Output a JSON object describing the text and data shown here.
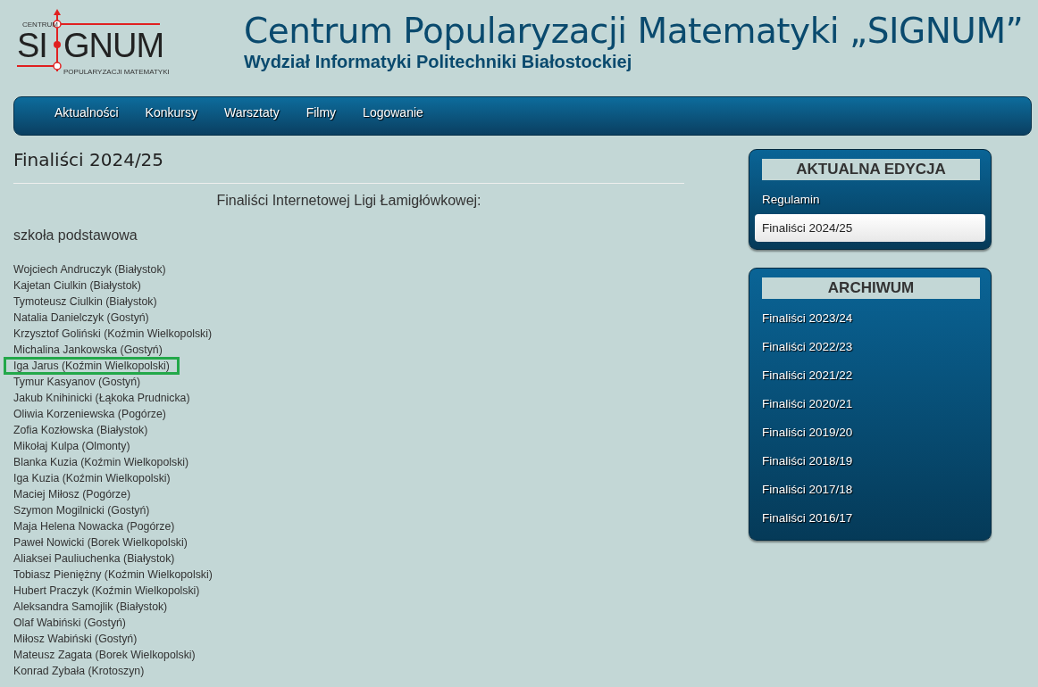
{
  "logo": {
    "top": "CENTRUM",
    "left": "SI",
    "right": "GNUM",
    "bottom": "POPULARYZACJI MATEMATYKI"
  },
  "header": {
    "title": "Centrum Popularyzacji Matematyki „SIGNUM”",
    "subtitle": "Wydział Informatyki Politechniki Białostockiej"
  },
  "nav": [
    "Aktualności",
    "Konkursy",
    "Warsztaty",
    "Filmy",
    "Logowanie"
  ],
  "page_title": "Finaliści 2024/25",
  "intro": "Finaliści Internetowej Ligi Łamigłówkowej:",
  "section": "szkoła podstawowa",
  "finalists": [
    {
      "text": "Wojciech Andruczyk (Białystok)",
      "highlighted": false
    },
    {
      "text": "Kajetan Ciulkin (Białystok)",
      "highlighted": false
    },
    {
      "text": "Tymoteusz Ciulkin (Białystok)",
      "highlighted": false
    },
    {
      "text": "Natalia Danielczyk (Gostyń)",
      "highlighted": false
    },
    {
      "text": "Krzysztof Goliński (Koźmin Wielkopolski)",
      "highlighted": false
    },
    {
      "text": "Michalina Jankowska (Gostyń)",
      "highlighted": false
    },
    {
      "text": "Iga Jarus (Koźmin Wielkopolski)",
      "highlighted": true
    },
    {
      "text": "Tymur Kasyanov (Gostyń)",
      "highlighted": false
    },
    {
      "text": "Jakub Knihinicki (Łąkoka Prudnicka)",
      "highlighted": false
    },
    {
      "text": "Oliwia Korzeniewska (Pogórze)",
      "highlighted": false
    },
    {
      "text": "Zofia Kozłowska (Białystok)",
      "highlighted": false
    },
    {
      "text": "Mikołaj Kulpa (Olmonty)",
      "highlighted": false
    },
    {
      "text": "Blanka Kuzia (Koźmin Wielkopolski)",
      "highlighted": false
    },
    {
      "text": "Iga Kuzia (Koźmin Wielkopolski)",
      "highlighted": false
    },
    {
      "text": "Maciej Miłosz (Pogórze)",
      "highlighted": false
    },
    {
      "text": "Szymon Mogilnicki (Gostyń)",
      "highlighted": false
    },
    {
      "text": "Maja Helena Nowacka (Pogórze)",
      "highlighted": false
    },
    {
      "text": "Paweł Nowicki (Borek Wielkopolski)",
      "highlighted": false
    },
    {
      "text": "Aliaksei Pauliuchenka (Białystok)",
      "highlighted": false
    },
    {
      "text": "Tobiasz Pieniężny (Koźmin Wielkopolski)",
      "highlighted": false
    },
    {
      "text": "Hubert Praczyk (Koźmin Wielkopolski)",
      "highlighted": false
    },
    {
      "text": "Aleksandra Samojlik (Białystok)",
      "highlighted": false
    },
    {
      "text": "Olaf Wabiński (Gostyń)",
      "highlighted": false
    },
    {
      "text": "Miłosz Wabiński (Gostyń)",
      "highlighted": false
    },
    {
      "text": "Mateusz Zagata (Borek Wielkopolski)",
      "highlighted": false
    },
    {
      "text": "Konrad Zybała (Krotoszyn)",
      "highlighted": false
    }
  ],
  "sidebar": [
    {
      "title": "AKTUALNA EDYCJA",
      "items": [
        {
          "label": "Regulamin",
          "selected": false
        },
        {
          "label": "Finaliści 2024/25",
          "selected": true
        }
      ]
    },
    {
      "title": "ARCHIWUM",
      "items": [
        {
          "label": "Finaliści 2023/24",
          "selected": false
        },
        {
          "label": "Finaliści 2022/23",
          "selected": false
        },
        {
          "label": "Finaliści 2021/22",
          "selected": false
        },
        {
          "label": "Finaliści 2020/21",
          "selected": false
        },
        {
          "label": "Finaliści 2019/20",
          "selected": false
        },
        {
          "label": "Finaliści 2018/19",
          "selected": false
        },
        {
          "label": "Finaliści 2017/18",
          "selected": false
        },
        {
          "label": "Finaliści 2016/17",
          "selected": false
        }
      ]
    }
  ]
}
